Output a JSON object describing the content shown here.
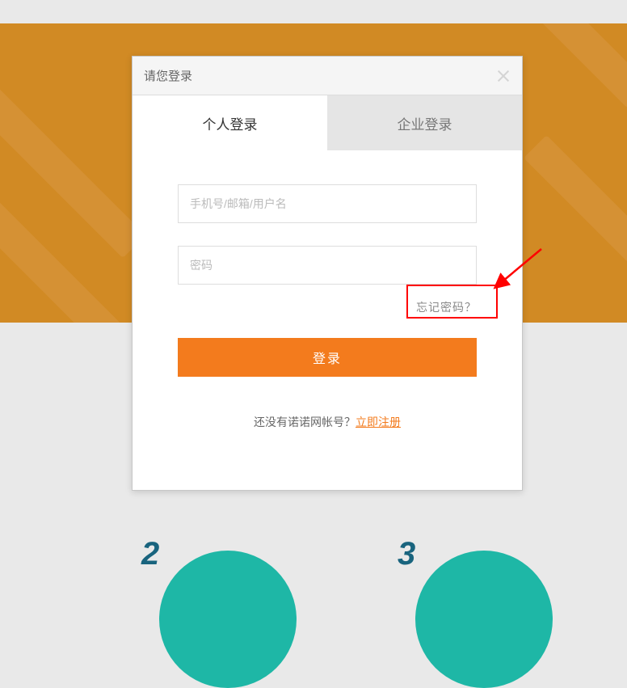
{
  "modal": {
    "title": "请您登录",
    "tabs": {
      "personal": "个人登录",
      "enterprise": "企业登录"
    },
    "inputs": {
      "username_placeholder": "手机号/邮箱/用户名",
      "password_placeholder": "密码"
    },
    "forgot_password": "忘记密码？",
    "login_button": "登录",
    "register_prompt": "还没有诺诺网帐号？",
    "register_link": "立即注册"
  },
  "steps": {
    "step2": "2",
    "step3": "3"
  }
}
